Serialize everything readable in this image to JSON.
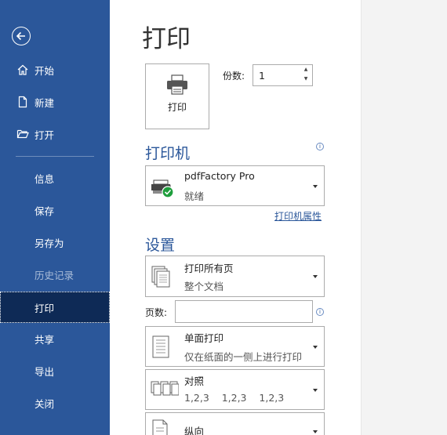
{
  "sidebar": {
    "items": [
      {
        "label": "开始"
      },
      {
        "label": "新建"
      },
      {
        "label": "打开"
      },
      {
        "label": "信息"
      },
      {
        "label": "保存"
      },
      {
        "label": "另存为"
      },
      {
        "label": "历史记录"
      },
      {
        "label": "打印"
      },
      {
        "label": "共享"
      },
      {
        "label": "导出"
      },
      {
        "label": "关闭"
      }
    ]
  },
  "main": {
    "title": "打印",
    "print_button_label": "打印",
    "copies_label": "份数:",
    "copies_value": "1",
    "printer_heading": "打印机",
    "printer": {
      "name": "pdfFactory Pro",
      "status": "就绪"
    },
    "printer_properties_link": "打印机属性",
    "settings_heading": "设置",
    "settings": {
      "range": {
        "title": "打印所有页",
        "subtitle": "整个文档"
      },
      "pages_label": "页数:",
      "pages_value": "",
      "sides": {
        "title": "单面打印",
        "subtitle": "仅在纸面的一侧上进行打印"
      },
      "collate": {
        "title": "对照",
        "subtitle": "1,2,3    1,2,3    1,2,3"
      },
      "orientation": {
        "title": "纵向"
      }
    }
  },
  "colors": {
    "sidebar_bg": "#2b579a",
    "sidebar_active": "#0e2a56",
    "accent": "#2b579a",
    "check_green": "#1e9e3c"
  }
}
